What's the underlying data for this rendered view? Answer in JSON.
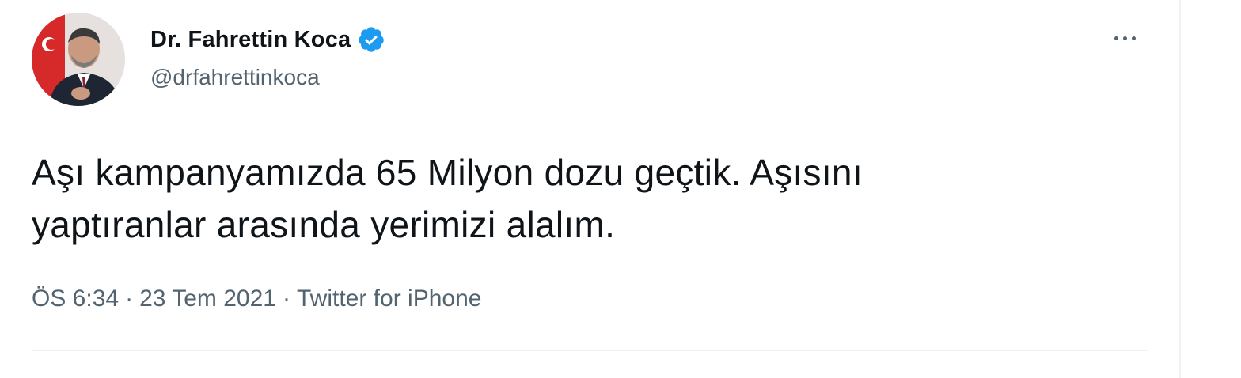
{
  "tweet": {
    "author": {
      "display_name": "Dr. Fahrettin Koca",
      "handle": "@drfahrettinkoca",
      "verified_color": "#1d9bf0"
    },
    "text_lines": [
      "Aşı kampanyamızda 65 Milyon dozu geçtik. Aşısını",
      "yaptıranlar arasında yerimizi alalım."
    ],
    "time": "ÖS 6:34",
    "date": "23 Tem 2021",
    "separator": "·",
    "source": "Twitter for iPhone"
  },
  "icons": {
    "more": "more-horizontal-icon",
    "verified": "verified-badge-icon"
  }
}
